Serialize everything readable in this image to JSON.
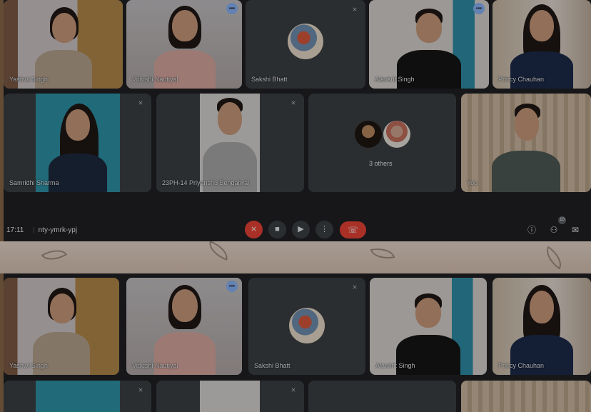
{
  "participants_top": [
    {
      "name": "Yashwi Singh"
    },
    {
      "name": "Vidushi Nautiyal"
    },
    {
      "name": "Sakshi Bhatt"
    },
    {
      "name": "Alankrit Singh"
    },
    {
      "name": "Princy Chauhan"
    },
    {
      "name": "Samridhi Sharma"
    },
    {
      "name": "23PH-14 Priyanshu Bengalwal"
    },
    {
      "name": "You"
    }
  ],
  "others_tile": {
    "label": "3 others"
  },
  "toolbar": {
    "time": "17:11",
    "meeting_code": "nty-ymrk-ypj",
    "people_badge": "10",
    "icons": [
      "mic-off-icon",
      "camera-icon",
      "present-icon",
      "more-icon",
      "hang-up-icon",
      "info-icon",
      "people-icon",
      "chat-icon"
    ]
  },
  "participants_bottom": [
    {
      "name": "Yashwi Singh"
    },
    {
      "name": "Vidushi Nautiyal"
    },
    {
      "name": "Sakshi Bhatt"
    },
    {
      "name": "Alankrit Singh"
    },
    {
      "name": "Princy Chauhan"
    }
  ],
  "colors": {
    "meet_bg": "#202124",
    "tile_bg": "#3c4043",
    "accent": "#8ab4f8",
    "danger": "#ea4335"
  }
}
